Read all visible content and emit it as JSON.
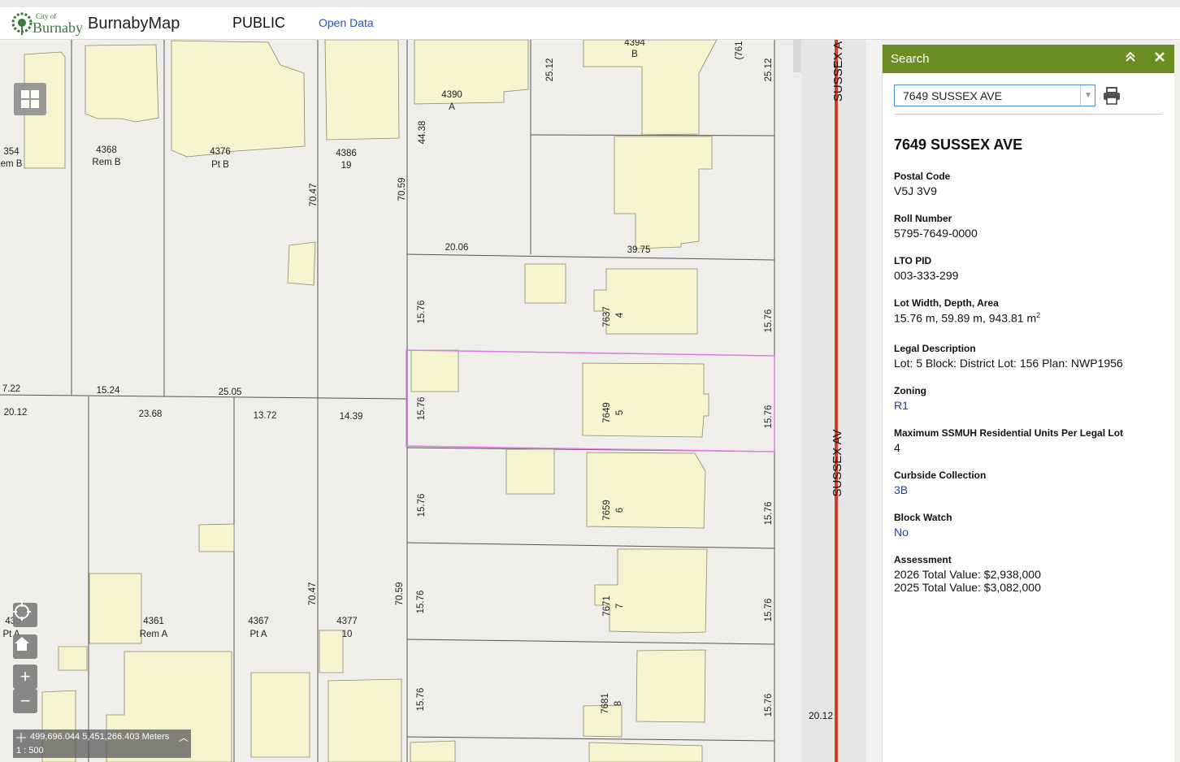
{
  "header": {
    "logo_small": "City of",
    "logo_big": "Burnaby",
    "app_title": "BurnabyMap",
    "mode_label": "PUBLIC",
    "open_data_link": "Open Data"
  },
  "toolbar": {
    "icons": [
      "search-icon",
      "layers-icon",
      "list-icon",
      "palette-icon",
      "ruler-icon",
      "print-icon",
      "person-icon",
      "document-icon",
      "info-icon",
      "help-icon"
    ]
  },
  "panel": {
    "title": "Search",
    "search_value": "7649 SUSSEX AVE",
    "result_title": "7649 SUSSEX AVE",
    "fields": {
      "postal_label": "Postal Code",
      "postal_value": "V5J 3V9",
      "roll_label": "Roll Number",
      "roll_value": "5795-7649-0000",
      "lto_label": "LTO PID",
      "lto_value": "003-333-299",
      "lot_label": "Lot Width, Depth, Area",
      "lot_value": "15.76 m, 59.89 m, 943.81 m",
      "lot_sup": "2",
      "legal_label": "Legal Description",
      "legal_value": "Lot: 5 Block: District Lot: 156 Plan: NWP1956",
      "zoning_label": "Zoning",
      "zoning_value": "R1",
      "ssmuh_label": "Maximum SSMUH Residential Units Per Legal Lot",
      "ssmuh_value": "4",
      "curbside_label": "Curbside Collection",
      "curbside_value": "3B",
      "blockwatch_label": "Block Watch",
      "blockwatch_value": "No",
      "assessment_label": "Assessment",
      "assessment_2026": "2026 Total Value: $2,938,000",
      "assessment_2025": "2025 Total Value: $3,082,000"
    }
  },
  "map": {
    "coordinates": "499,696.044 5,451,266.403 Meters",
    "scale": "1 : 500",
    "street_labels": [
      "SUSSEX A",
      "SUSSEX AV"
    ],
    "street_dim": "20.12",
    "lot_labels": [
      {
        "num": "4394",
        "sub": "B"
      },
      {
        "num": "4390",
        "sub": "A"
      },
      {
        "num": "354",
        "sub": "em B"
      },
      {
        "num": "4368",
        "sub": "Rem B"
      },
      {
        "num": "4376",
        "sub": "Pt B"
      },
      {
        "num": "4386",
        "sub": "19"
      },
      {
        "num": "4361",
        "sub": "Rem A"
      },
      {
        "num": "4367",
        "sub": "Pt A"
      },
      {
        "num": "4377",
        "sub": "10"
      },
      {
        "num": "435",
        "sub": "Pt A"
      }
    ],
    "sussex_lots": [
      {
        "num": "7637",
        "sub": "4"
      },
      {
        "num": "7649",
        "sub": "5"
      },
      {
        "num": "7659",
        "sub": "6"
      },
      {
        "num": "7671",
        "sub": "7"
      },
      {
        "num": "7681",
        "sub": "8"
      }
    ],
    "dimensions": [
      "25.12",
      "25.12",
      "44.38",
      "70.47",
      "70.59",
      "20.06",
      "39.75",
      "15.76",
      "15.76",
      "7.22",
      "15.24",
      "25.05",
      "20.12",
      "23.68",
      "13.72",
      "14.39",
      "70.47",
      "70.59",
      "(761"
    ]
  }
}
